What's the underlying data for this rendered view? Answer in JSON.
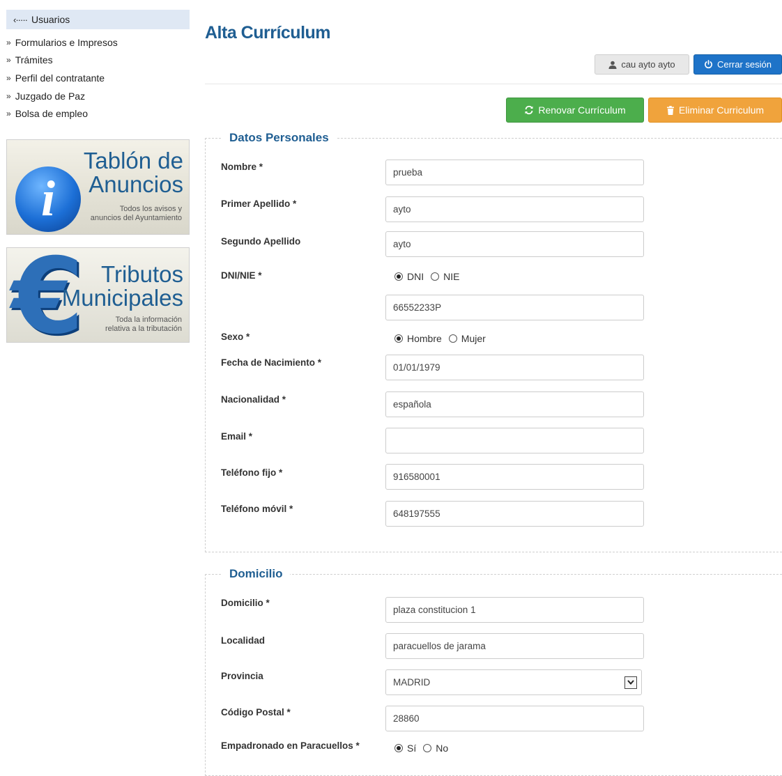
{
  "sidebar": {
    "back_label": "Usuarios",
    "back_arrow": "‹·····",
    "bullet": "»",
    "items": [
      {
        "label": "Formularios e Impresos"
      },
      {
        "label": "Trámites"
      },
      {
        "label": "Perfil del contratante"
      },
      {
        "label": "Juzgado de Paz"
      },
      {
        "label": "Bolsa de empleo"
      }
    ],
    "banners": {
      "tablon": {
        "title_1": "Tablón de",
        "title_2": "Anuncios",
        "sub_1": "Todos los avisos y",
        "sub_2": "anuncios del Ayuntamiento",
        "icon": "info-icon",
        "glyph": "i"
      },
      "tributos": {
        "title_1": "Tributos",
        "title_2": "Municipales",
        "sub_1": "Toda la información",
        "sub_2": "relativa a la tributación",
        "icon": "euro-icon",
        "glyph": "€"
      }
    }
  },
  "header": {
    "title": "Alta Currículum",
    "user_label": "cau ayto ayto",
    "logout_label": "Cerrar sesión"
  },
  "actions": {
    "renew_label": "Renovar Currículum",
    "delete_label": "Eliminar Curriculum"
  },
  "personal": {
    "legend": "Datos Personales",
    "nombre": {
      "label": "Nombre *",
      "value": "prueba"
    },
    "primer_apellido": {
      "label": "Primer Apellido *",
      "value": "ayto"
    },
    "segundo_apellido": {
      "label": "Segundo Apellido",
      "value": "ayto"
    },
    "dni": {
      "label": "DNI/NIE *",
      "option_1": "DNI",
      "option_2": "NIE",
      "selected": "DNI",
      "value": "66552233P"
    },
    "sexo": {
      "label": "Sexo *",
      "option_1": "Hombre",
      "option_2": "Mujer",
      "selected": "Hombre"
    },
    "fecha": {
      "label": "Fecha de Nacimiento *",
      "value": "01/01/1979"
    },
    "nacionalidad": {
      "label": "Nacionalidad *",
      "value": "española"
    },
    "email": {
      "label": "Email *",
      "value": ""
    },
    "telefono_fijo": {
      "label": "Teléfono fijo *",
      "value": "916580001"
    },
    "telefono_movil": {
      "label": "Teléfono móvil *",
      "value": "648197555"
    }
  },
  "domicilio": {
    "legend": "Domicilio",
    "domicilio": {
      "label": "Domicilio *",
      "value": "plaza constitucion 1"
    },
    "localidad": {
      "label": "Localidad",
      "value": "paracuellos de jarama"
    },
    "provincia": {
      "label": "Provincia",
      "value": "MADRID"
    },
    "codigo_postal": {
      "label": "Código Postal *",
      "value": "28860"
    },
    "empadronado": {
      "label": "Empadronado en Paracuellos *",
      "option_1": "Sí",
      "option_2": "No",
      "selected": "Sí"
    }
  },
  "colors": {
    "brand_blue": "#1f5e92",
    "logout_blue": "#1e73c8",
    "renew_green": "#4cae4c",
    "delete_orange": "#f0a33c"
  }
}
